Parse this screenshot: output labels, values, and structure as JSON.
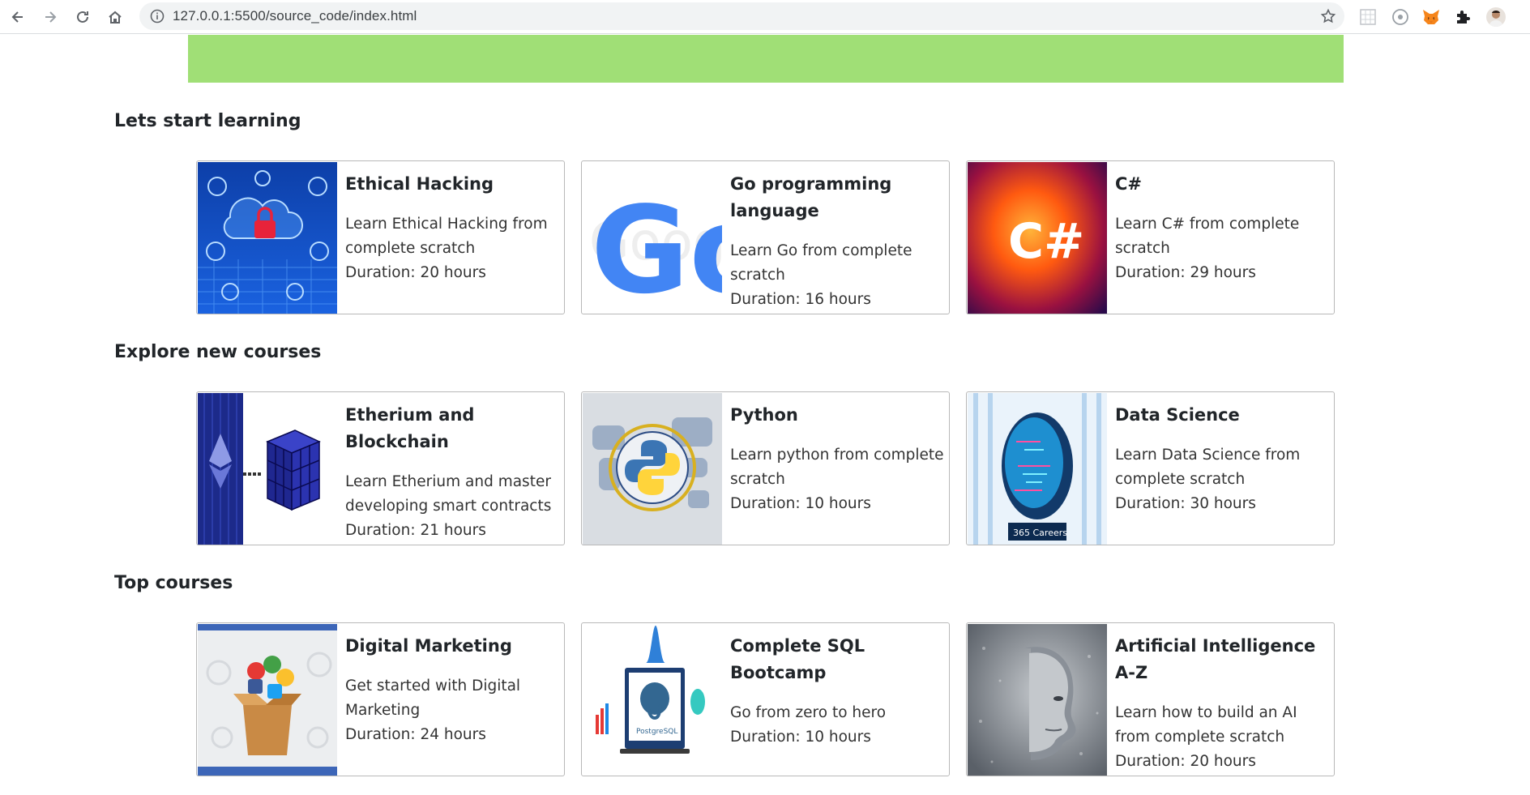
{
  "browser": {
    "url": "127.0.0.1:5500/source_code/index.html"
  },
  "colors": {
    "banner": "#a0df76"
  },
  "sections": [
    {
      "heading": "Lets start learning",
      "cards": [
        {
          "title": "Ethical Hacking",
          "desc": "Learn Ethical Hacking from complete scratch",
          "duration": "Duration: 20 hours"
        },
        {
          "title": "Go programming language",
          "desc": "Learn Go from complete scratch",
          "duration": "Duration: 16 hours"
        },
        {
          "title": "C#",
          "desc": "Learn C# from complete scratch",
          "duration": "Duration: 29 hours"
        }
      ]
    },
    {
      "heading": "Explore new courses",
      "cards": [
        {
          "title": "Etherium and Blockchain",
          "desc": "Learn Etherium and master developing smart contracts",
          "duration": "Duration: 21 hours"
        },
        {
          "title": "Python",
          "desc": "Learn python from complete scratch",
          "duration": "Duration: 10 hours"
        },
        {
          "title": "Data Science",
          "desc": "Learn Data Science from complete scratch",
          "duration": "Duration: 30 hours"
        }
      ]
    },
    {
      "heading": "Top courses",
      "cards": [
        {
          "title": "Digital Marketing",
          "desc": "Get started with Digital Marketing",
          "duration": "Duration: 24 hours"
        },
        {
          "title": "Complete SQL Bootcamp",
          "desc": "Go from zero to hero",
          "duration": "Duration: 10 hours"
        },
        {
          "title": "Artificial Intelligence A-Z",
          "desc": "Learn how to build an AI from complete scratch",
          "duration": "Duration: 20 hours"
        }
      ]
    }
  ],
  "thumb_text": {
    "go_logo": "Go",
    "csharp_logo": "C#",
    "careers_badge": "365 Careers",
    "postgres_label": "PostgreSQL"
  }
}
